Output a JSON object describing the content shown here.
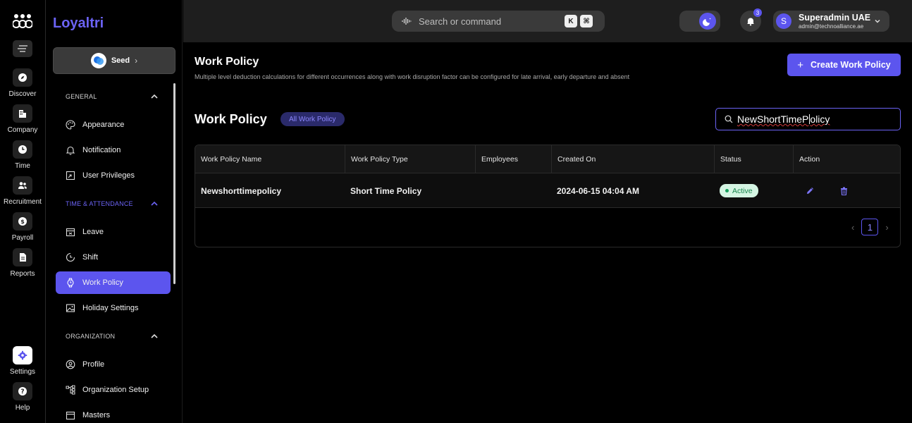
{
  "rail": {
    "items": [
      {
        "label": "Discover",
        "icon": "compass-icon"
      },
      {
        "label": "Company",
        "icon": "building-icon"
      },
      {
        "label": "Time",
        "icon": "clock-icon"
      },
      {
        "label": "Recruitment",
        "icon": "people-icon"
      },
      {
        "label": "Payroll",
        "icon": "dollar-icon"
      },
      {
        "label": "Reports",
        "icon": "document-icon"
      },
      {
        "label": "Settings",
        "icon": "gear-icon"
      },
      {
        "label": "Help",
        "icon": "help-icon"
      }
    ]
  },
  "sidebar": {
    "brand": "Loyaltri",
    "seed_label": "Seed",
    "sections": {
      "general": "GENERAL",
      "time_attendance": "TIME & ATTENDANCE",
      "organization": "ORGANIZATION"
    },
    "items": {
      "appearance": "Appearance",
      "notification": "Notification",
      "user_privileges": "User Privileges",
      "leave": "Leave",
      "shift": "Shift",
      "work_policy": "Work Policy",
      "holiday_settings": "Holiday Settings",
      "profile": "Profile",
      "organization_setup": "Organization Setup",
      "masters": "Masters"
    }
  },
  "topbar": {
    "search_placeholder": "Search or command",
    "kbd_k": "K",
    "kbd_cmd": "⌘",
    "notification_count": "3",
    "user_initial": "S",
    "user_name": "Superadmin UAE",
    "user_email": "admin@technoalliance.ae"
  },
  "main": {
    "title": "Work Policy",
    "subtitle": "Multiple level deduction calculations for different occurrences along with work disruption factor can be configured for late arrival, early departure and absent",
    "create_button": "Create Work Policy",
    "section_title": "Work Policy",
    "chip": "All Work Policy",
    "search_value_prefix": "NewShortTimeP",
    "search_value_suffix": "olicy",
    "table": {
      "headers": [
        "Work Policy Name",
        "Work Policy Type",
        "Employees",
        "Created On",
        "Status",
        "Action"
      ],
      "rows": [
        {
          "name": "Newshorttimepolicy",
          "type": "Short Time Policy",
          "employees": "",
          "created_on": "2024-06-15 04:04 AM",
          "status": "Active"
        }
      ]
    },
    "pagination": {
      "current": "1"
    }
  },
  "colors": {
    "accent": "#5c55ee",
    "status_active_bg": "#d5f5e3",
    "status_active_text": "#16844b"
  }
}
